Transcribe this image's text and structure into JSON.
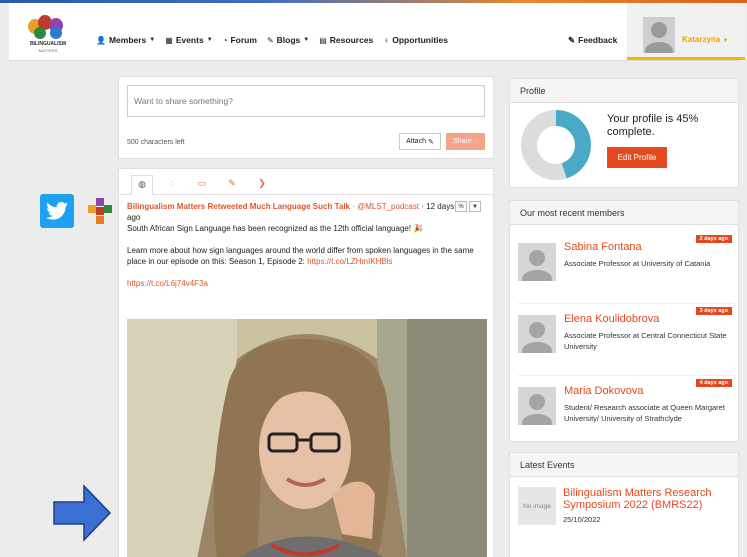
{
  "nav": {
    "logo_text": "BILINGUALISM",
    "logo_sub": "MATTERS",
    "items": [
      {
        "label": "Members",
        "icon": "users-icon",
        "glyph": "👤",
        "caret": true
      },
      {
        "label": "Events",
        "icon": "calendar-icon",
        "glyph": "▦",
        "caret": true
      },
      {
        "label": "Forum",
        "icon": "chat-icon",
        "glyph": "◔",
        "caret": false
      },
      {
        "label": "Blogs",
        "icon": "pencil-icon",
        "glyph": "✎",
        "caret": true
      },
      {
        "label": "Resources",
        "icon": "book-icon",
        "glyph": "▤",
        "caret": false
      },
      {
        "label": "Opportunities",
        "icon": "lightbulb-icon",
        "glyph": "♀",
        "caret": false
      }
    ],
    "feedback_label": "Feedback",
    "user_name": "Katarzyna"
  },
  "share": {
    "placeholder": "Want to share something?",
    "chars_left": "500 characters left",
    "attach_label": "Attach",
    "share_label": "Share"
  },
  "feed": {
    "tabs": [
      {
        "icon": "globe-icon",
        "glyph": "◍"
      },
      {
        "icon": "comment-icon",
        "glyph": "◌"
      },
      {
        "icon": "newspaper-icon",
        "glyph": "▭"
      },
      {
        "icon": "pencil-icon",
        "glyph": "✎"
      },
      {
        "icon": "twitter-icon",
        "glyph": "❯"
      }
    ],
    "post": {
      "author": "Bilingualism Matters Retweeted Much Language Such Talk",
      "handle": "· @MLST_podcast",
      "time": "· 12 days ago",
      "line1": "South African Sign Language has been recognized as the 12th official language! 🎉",
      "line2": "Learn more about how sign languages around the world differ from spoken languages in the same place in our episode on this: Season 1, Episode 2:",
      "link1": "https://t.co/LZHmIKHBls",
      "link2": "https://t.co/L6j74v4F3a"
    }
  },
  "profile": {
    "title": "Profile",
    "text": "Your profile is 45% complete.",
    "percent": 45,
    "edit_label": "Edit Profile"
  },
  "members": {
    "title": "Our most recent members",
    "items": [
      {
        "name": "Sabina Fontana",
        "desc": "Associate Professor at University of Catania",
        "badge": "2 days ago"
      },
      {
        "name": "Elena Koulidobrova",
        "desc": "Associate Professor at Central Connecticut State University",
        "badge": "3 days ago"
      },
      {
        "name": "Maria Dokovova",
        "desc": "Student/ Research associate at Queen Margaret University/ University of Strathclyde",
        "badge": "4 days ago"
      }
    ]
  },
  "events": {
    "title": "Latest Events",
    "no_image": "No image",
    "event_title": "Bilingualism Matters Research Symposium 2022 (BMRS22)",
    "event_date": "25/10/2022"
  },
  "colors": {
    "accent": "#e5491f",
    "twitter": "#1da1f2",
    "donut_fill": "#4aa8c8",
    "donut_bg": "#dcdcdc"
  }
}
